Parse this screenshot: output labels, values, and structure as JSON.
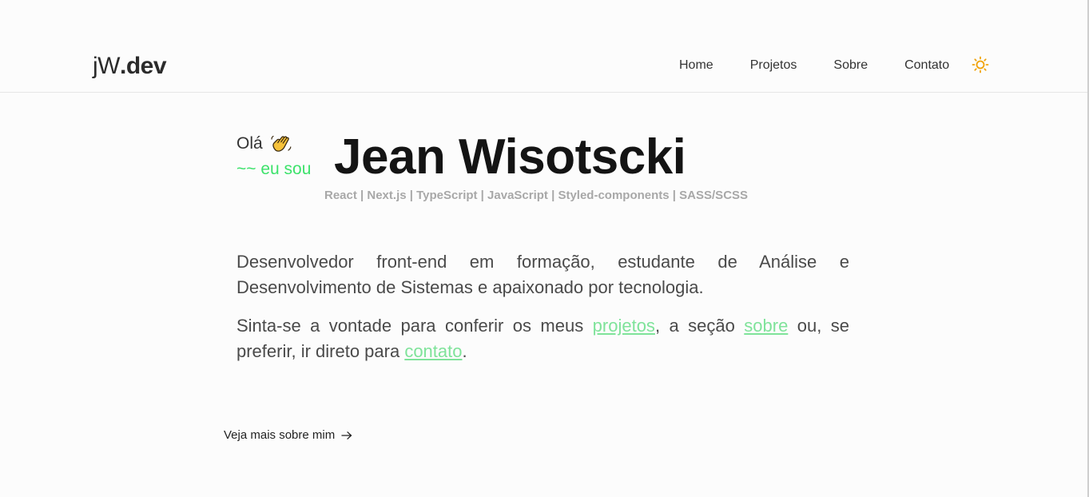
{
  "header": {
    "logo": {
      "prefix": "jW",
      "suffix": ".dev"
    },
    "nav": [
      {
        "label": "Home"
      },
      {
        "label": "Projetos"
      },
      {
        "label": "Sobre"
      },
      {
        "label": "Contato"
      }
    ],
    "theme_toggle_icon": "sun-icon",
    "theme_toggle_color": "#f0a30a"
  },
  "hero": {
    "greeting": "Olá",
    "greeting_icon": "waving-hand-icon",
    "intro": "~~ eu sou",
    "name": "Jean Wisotscki",
    "stack": "React | Next.js | TypeScript | JavaScript | Styled-components | SASS/SCSS"
  },
  "about": {
    "paragraph1": "Desenvolvedor front-end em formação, estudante de Análise e Desenvolvimento de Sistemas e apaixonado por tecnologia.",
    "p2_part1": "Sinta-se a vontade para conferir os meus ",
    "p2_link1": "projetos",
    "p2_part2": ", a seção ",
    "p2_link2": "sobre",
    "p2_part3": " ou, se preferir, ir direto para ",
    "p2_link3": "contato",
    "p2_part4": "."
  },
  "more": {
    "label": "Veja mais sobre mim",
    "icon": "arrow-right-icon"
  },
  "colors": {
    "accent": "#3de26b",
    "link": "#7fe39a",
    "heading": "#141414",
    "muted": "#a8a8a8"
  }
}
